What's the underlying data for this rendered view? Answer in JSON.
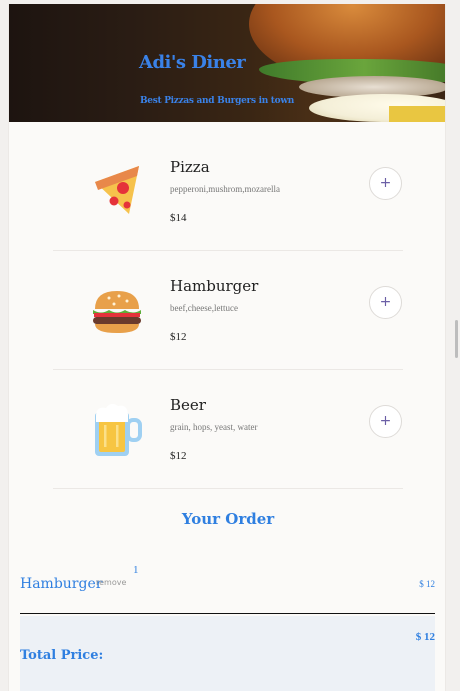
{
  "header": {
    "title": "Adi's Diner",
    "subtitle": "Best Pizzas and Burgers in town"
  },
  "menu": [
    {
      "name": "Pizza",
      "description": "pepperoni,mushrom,mozarella",
      "price": "$14",
      "icon": "pizza-icon",
      "add_label": "+"
    },
    {
      "name": "Hamburger",
      "description": "beef,cheese,lettuce",
      "price": "$12",
      "icon": "hamburger-icon",
      "add_label": "+"
    },
    {
      "name": "Beer",
      "description": "grain, hops, yeast, water",
      "price": "$12",
      "icon": "beer-icon",
      "add_label": "+"
    }
  ],
  "order": {
    "title": "Your Order",
    "items": [
      {
        "quantity": "1",
        "name": "Hamburger",
        "remove_label": "remove",
        "price": "$ 12"
      }
    ],
    "total_label": "Total Price:",
    "total_price": "$ 12"
  },
  "colors": {
    "accent": "#2f7fe0",
    "add_button_text": "#6b5fa6"
  }
}
